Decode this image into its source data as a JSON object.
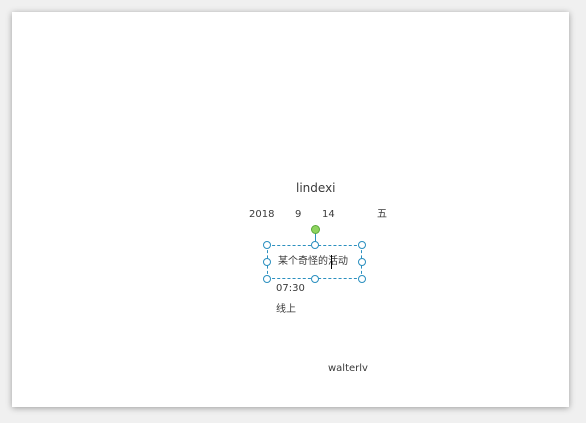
{
  "card": {
    "name": "lindexi",
    "date": {
      "year": "2018",
      "month": "9",
      "day": "14",
      "weekday": "五"
    },
    "event_title": "某个奇怪的活动",
    "time": "07:30",
    "location": "线上",
    "author": "walterlv"
  },
  "colors": {
    "selection": "#2a8fbf",
    "rotation_handle": "#8fd45f",
    "text": "#3a3a3a"
  }
}
